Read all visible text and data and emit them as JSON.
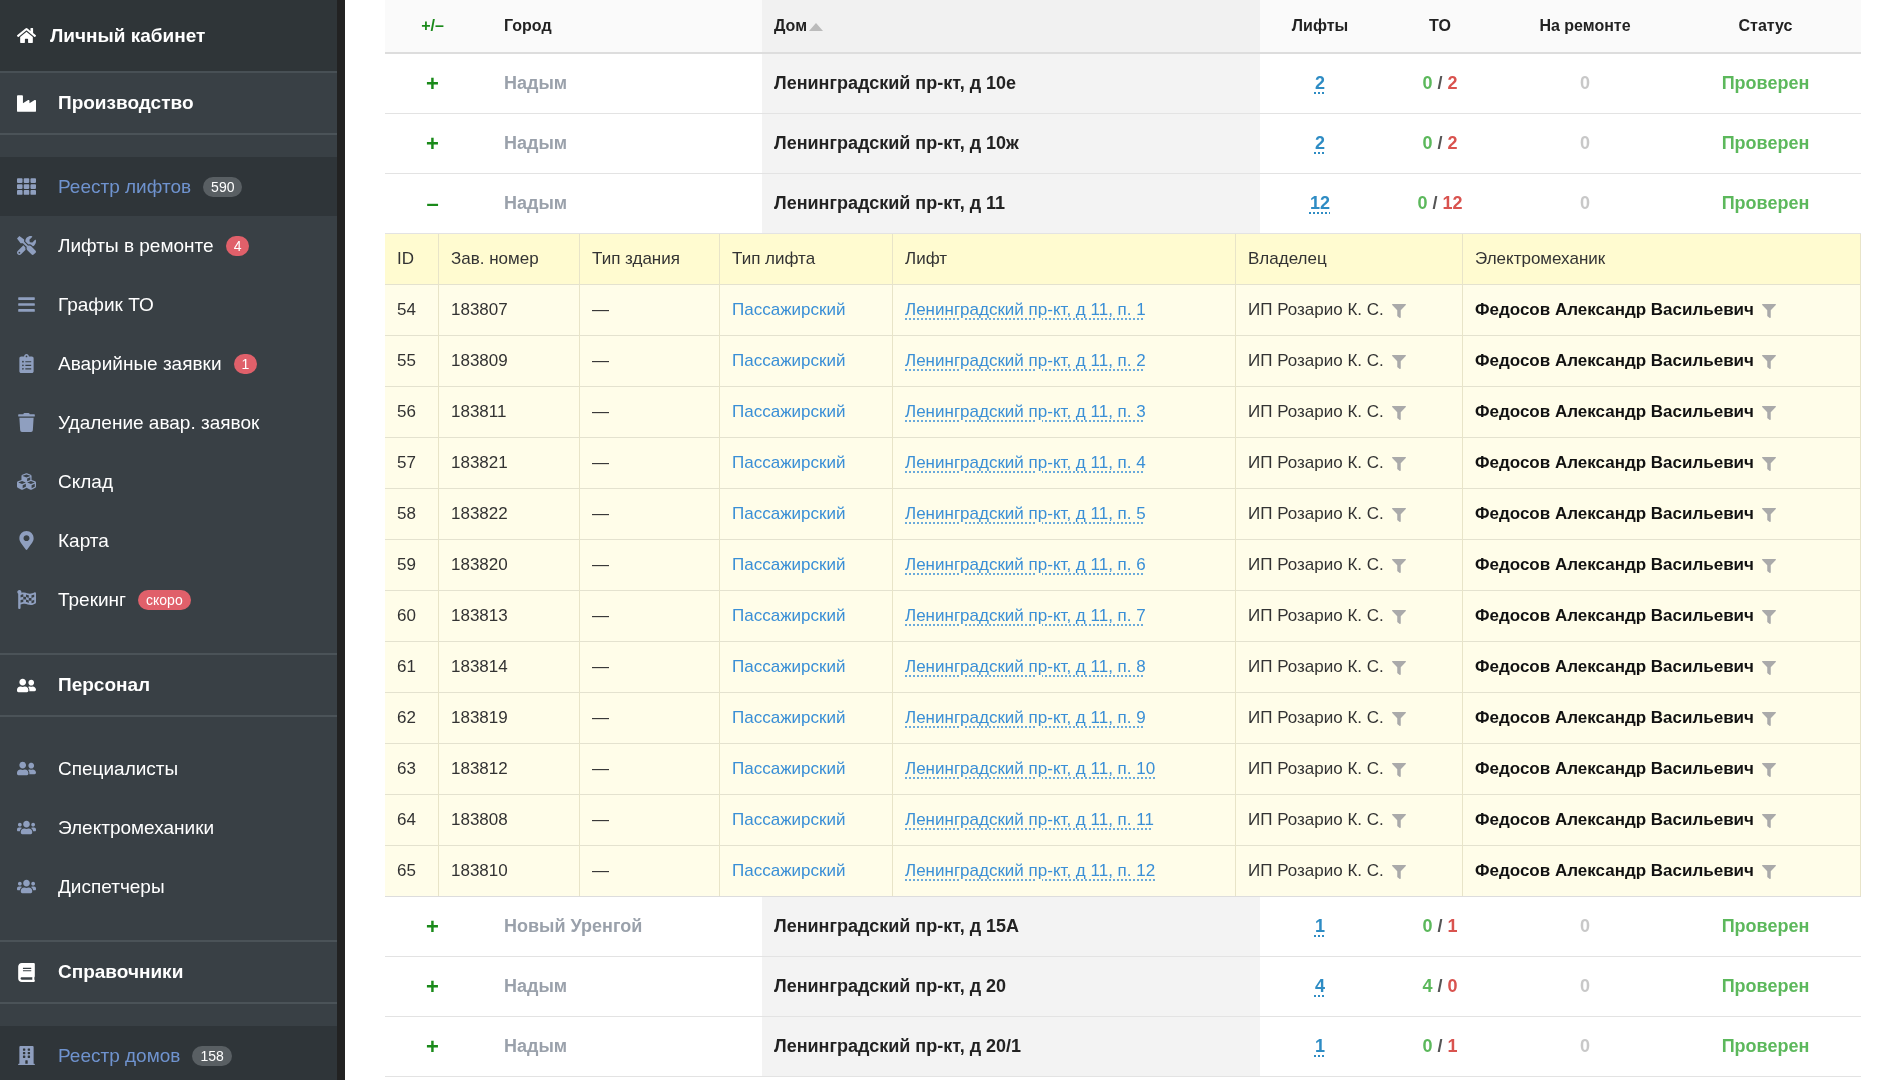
{
  "sidebar": {
    "header": "Личный кабинет",
    "groups": [
      {
        "title": "Производство",
        "items": [
          {
            "label": "Реестр лифтов",
            "selected": true,
            "badge": {
              "text": "590",
              "kind": "count"
            }
          },
          {
            "label": "Лифты в ремонте",
            "selected": false,
            "badge": {
              "text": "4",
              "kind": "alert"
            }
          },
          {
            "label": "График ТО",
            "selected": false
          },
          {
            "label": "Аварийные заявки",
            "selected": false,
            "badge": {
              "text": "1",
              "kind": "alert"
            }
          },
          {
            "label": "Удаление авар. заявок",
            "selected": false
          },
          {
            "label": "Склад",
            "selected": false
          },
          {
            "label": "Карта",
            "selected": false
          },
          {
            "label": "Трекинг",
            "selected": false,
            "badge": {
              "text": "скоро",
              "kind": "alert"
            }
          }
        ]
      },
      {
        "title": "Персонал",
        "items": [
          {
            "label": "Специалисты",
            "selected": false
          },
          {
            "label": "Электромеханики",
            "selected": false
          },
          {
            "label": "Диспетчеры",
            "selected": false
          }
        ]
      },
      {
        "title": "Справочники",
        "items": [
          {
            "label": "Реестр домов",
            "selected": true,
            "badge": {
              "text": "158",
              "kind": "count"
            }
          }
        ]
      }
    ]
  },
  "table": {
    "columns": [
      {
        "label": "+/–",
        "sorted": false
      },
      {
        "label": "Город",
        "sorted": false
      },
      {
        "label": "Дом",
        "sorted": true
      },
      {
        "label": "Лифты",
        "sorted": false
      },
      {
        "label": "ТО",
        "sorted": false
      },
      {
        "label": "На ремонте",
        "sorted": false
      },
      {
        "label": "Статус",
        "sorted": false
      }
    ],
    "rows": [
      {
        "toggle": "+",
        "city": "Надым",
        "house": "Ленинградский пр-кт, д 10е",
        "lifts": "2",
        "to_done": "0",
        "to_separator": "/",
        "to_total": "2",
        "repair": "0",
        "status": "Проверен"
      },
      {
        "toggle": "+",
        "city": "Надым",
        "house": "Ленинградский пр-кт, д 10ж",
        "lifts": "2",
        "to_done": "0",
        "to_separator": "/",
        "to_total": "2",
        "repair": "0",
        "status": "Проверен"
      },
      {
        "toggle": "–",
        "city": "Надым",
        "house": "Ленинградский пр-кт, д 11",
        "lifts": "12",
        "to_done": "0",
        "to_separator": "/",
        "to_total": "12",
        "repair": "0",
        "status": "Проверен",
        "details": {
          "columns": [
            "ID",
            "Зав. номер",
            "Тип здания",
            "Тип лифта",
            "Лифт",
            "Владелец",
            "Электромеханик"
          ],
          "rows": [
            {
              "id": "54",
              "serial": "183807",
              "building": "—",
              "type": "Пассажирский",
              "lift": "Ленинградский пр-кт, д 11, п. 1",
              "owner": "ИП Розарио К. С.",
              "mechanic": "Федосов Александр Васильевич"
            },
            {
              "id": "55",
              "serial": "183809",
              "building": "—",
              "type": "Пассажирский",
              "lift": "Ленинградский пр-кт, д 11, п. 2",
              "owner": "ИП Розарио К. С.",
              "mechanic": "Федосов Александр Васильевич"
            },
            {
              "id": "56",
              "serial": "183811",
              "building": "—",
              "type": "Пассажирский",
              "lift": "Ленинградский пр-кт, д 11, п. 3",
              "owner": "ИП Розарио К. С.",
              "mechanic": "Федосов Александр Васильевич"
            },
            {
              "id": "57",
              "serial": "183821",
              "building": "—",
              "type": "Пассажирский",
              "lift": "Ленинградский пр-кт, д 11, п. 4",
              "owner": "ИП Розарио К. С.",
              "mechanic": "Федосов Александр Васильевич"
            },
            {
              "id": "58",
              "serial": "183822",
              "building": "—",
              "type": "Пассажирский",
              "lift": "Ленинградский пр-кт, д 11, п. 5",
              "owner": "ИП Розарио К. С.",
              "mechanic": "Федосов Александр Васильевич"
            },
            {
              "id": "59",
              "serial": "183820",
              "building": "—",
              "type": "Пассажирский",
              "lift": "Ленинградский пр-кт, д 11, п. 6",
              "owner": "ИП Розарио К. С.",
              "mechanic": "Федосов Александр Васильевич"
            },
            {
              "id": "60",
              "serial": "183813",
              "building": "—",
              "type": "Пассажирский",
              "lift": "Ленинградский пр-кт, д 11, п. 7",
              "owner": "ИП Розарио К. С.",
              "mechanic": "Федосов Александр Васильевич"
            },
            {
              "id": "61",
              "serial": "183814",
              "building": "—",
              "type": "Пассажирский",
              "lift": "Ленинградский пр-кт, д 11, п. 8",
              "owner": "ИП Розарио К. С.",
              "mechanic": "Федосов Александр Васильевич"
            },
            {
              "id": "62",
              "serial": "183819",
              "building": "—",
              "type": "Пассажирский",
              "lift": "Ленинградский пр-кт, д 11, п. 9",
              "owner": "ИП Розарио К. С.",
              "mechanic": "Федосов Александр Васильевич"
            },
            {
              "id": "63",
              "serial": "183812",
              "building": "—",
              "type": "Пассажирский",
              "lift": "Ленинградский пр-кт, д 11, п. 10",
              "owner": "ИП Розарио К. С.",
              "mechanic": "Федосов Александр Васильевич"
            },
            {
              "id": "64",
              "serial": "183808",
              "building": "—",
              "type": "Пассажирский",
              "lift": "Ленинградский пр-кт, д 11, п. 11",
              "owner": "ИП Розарио К. С.",
              "mechanic": "Федосов Александр Васильевич"
            },
            {
              "id": "65",
              "serial": "183810",
              "building": "—",
              "type": "Пассажирский",
              "lift": "Ленинградский пр-кт, д 11, п. 12",
              "owner": "ИП Розарио К. С.",
              "mechanic": "Федосов Александр Васильевич"
            }
          ]
        }
      },
      {
        "toggle": "+",
        "city": "Новый Уренгой",
        "house": "Ленинградский пр-кт, д 15А",
        "lifts": "1",
        "to_done": "0",
        "to_separator": "/",
        "to_total": "1",
        "repair": "0",
        "status": "Проверен"
      },
      {
        "toggle": "+",
        "city": "Надым",
        "house": "Ленинградский пр-кт, д 20",
        "lifts": "4",
        "to_done": "4",
        "to_separator": "/",
        "to_total": "0",
        "repair": "0",
        "status": "Проверен"
      },
      {
        "toggle": "+",
        "city": "Надым",
        "house": "Ленинградский пр-кт, д 20/1",
        "lifts": "1",
        "to_done": "0",
        "to_separator": "/",
        "to_total": "1",
        "repair": "0",
        "status": "Проверен"
      }
    ]
  }
}
